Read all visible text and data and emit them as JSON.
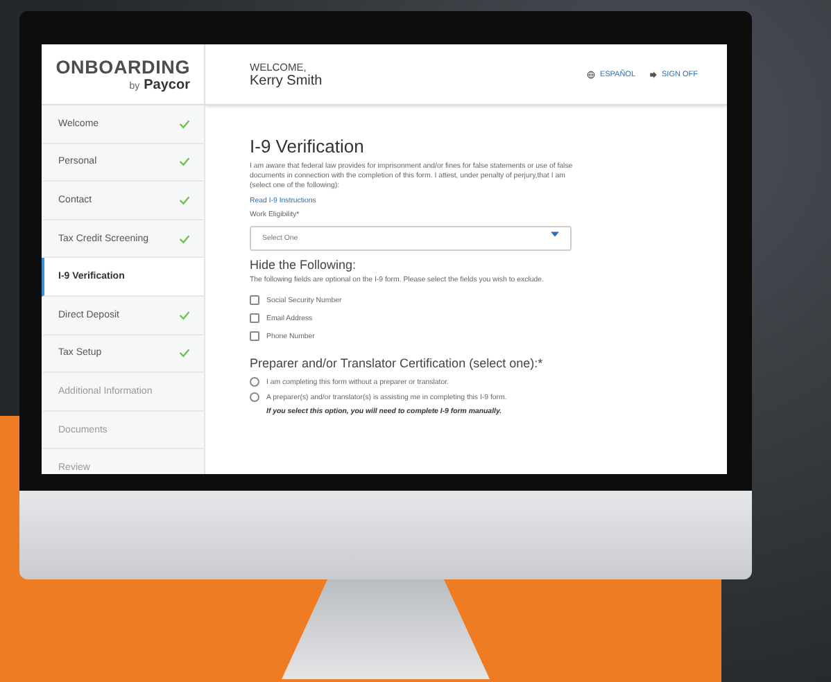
{
  "logo": {
    "title": "ONBOARDING",
    "byline": "by",
    "brand": "Paycor"
  },
  "header": {
    "greeting": "WELCOME,",
    "name": "Kerry Smith",
    "language_link": "ESPAÑOL",
    "sign_off_link": "SIGN OFF"
  },
  "sidebar": {
    "items": [
      {
        "label": "Welcome",
        "completed": true,
        "selected": false
      },
      {
        "label": "Personal",
        "completed": true,
        "selected": false
      },
      {
        "label": "Contact",
        "completed": true,
        "selected": false
      },
      {
        "label": "Tax Credit Screening",
        "completed": true,
        "selected": false
      },
      {
        "label": "I-9 Verification",
        "completed": false,
        "selected": true
      },
      {
        "label": "Direct Deposit",
        "completed": true,
        "selected": false
      },
      {
        "label": "Tax Setup",
        "completed": true,
        "selected": false
      },
      {
        "label": "Additional Information",
        "completed": false,
        "selected": false
      },
      {
        "label": "Documents",
        "completed": false,
        "selected": false
      },
      {
        "label": "Review",
        "completed": false,
        "selected": false
      }
    ]
  },
  "form": {
    "title": "I-9 Verification",
    "intro": "I am aware that federal law provides for imprisonment and/or fines for false statements or use of false documents in connection with the completion of this form. I attest, under penalty of perjury,that I am (select one of the following):",
    "instructions_link": "Read I-9 Instructions",
    "work_eligibility": {
      "label": "Work Eligibility*",
      "placeholder": "Select One"
    },
    "hide_section": {
      "heading": "Hide the Following:",
      "description": "The following fields are optional on the I-9 form. Please select the fields you wish to exclude.",
      "options": [
        {
          "label": "Social Security Number",
          "checked": false
        },
        {
          "label": "Email Address",
          "checked": false
        },
        {
          "label": "Phone Number",
          "checked": false
        }
      ]
    },
    "preparer_section": {
      "heading": "Preparer and/or Translator Certification (select one):*",
      "options": [
        {
          "label": "I am completing this form without a preparer or translator.",
          "selected": false
        },
        {
          "label": "A preparer(s) and/or translator(s) is assisting me in completing this I-9 form.",
          "selected": false
        }
      ],
      "note": "If you select this option, you will need to complete I-9 form manually."
    }
  }
}
